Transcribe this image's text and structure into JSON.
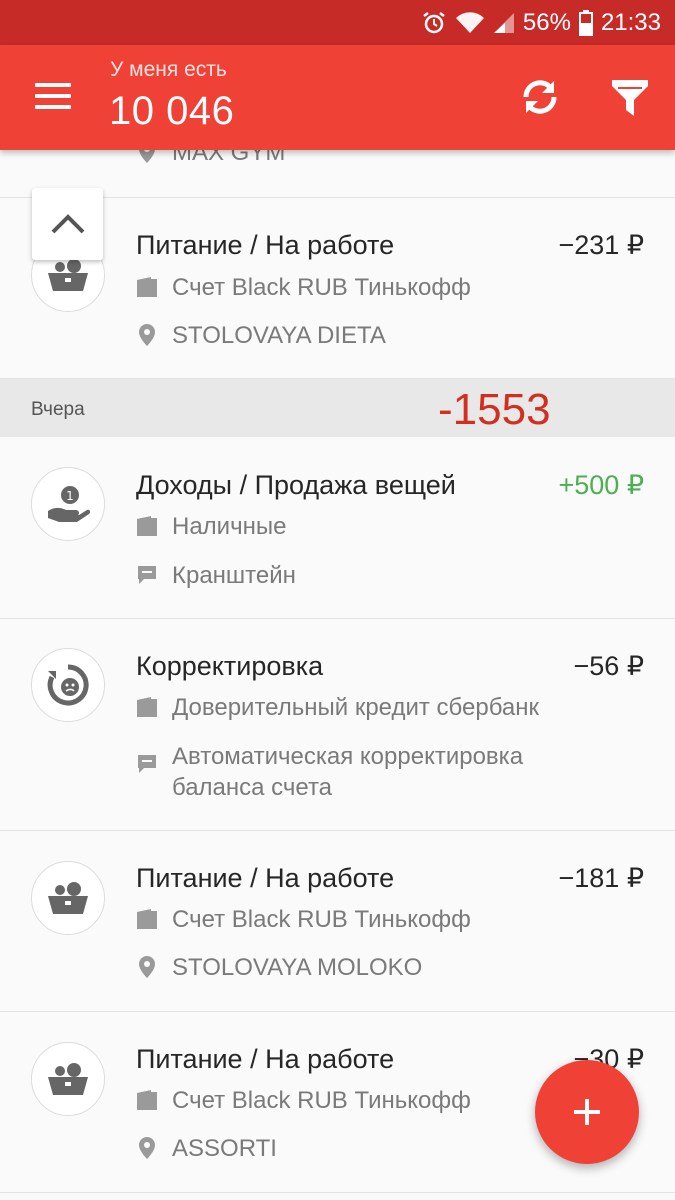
{
  "status_bar": {
    "battery": "56%",
    "time": "21:33"
  },
  "header": {
    "balance_caption": "У меня есть",
    "balance": "10 046",
    "menu_icon": "hamburger-menu-icon",
    "sync_icon": "sync-icon",
    "filter_icon": "filter-icon"
  },
  "partial_item": {
    "place": "MAX GYM"
  },
  "transactions_today": [
    {
      "category": "Питание  / На работе",
      "amount": "−231 ₽",
      "account": "Счет Black RUB Тинькофф",
      "place": "STOLOVAYA DIETA",
      "icon": "basket-icon"
    }
  ],
  "day_group": {
    "label": "Вчера",
    "total": "-1553"
  },
  "transactions_yesterday": [
    {
      "category": "Доходы / Продажа вещей",
      "amount": "+500 ₽",
      "account": "Наличные",
      "note": "Кранштейн",
      "icon": "hand-coin-icon"
    },
    {
      "category": "Корректировка",
      "amount": "−56 ₽",
      "account": "Доверительный кредит сбербанк",
      "note": "Автоматическая корректировка баланса счета",
      "icon": "adjustment-icon"
    },
    {
      "category": "Питание  / На работе",
      "amount": "−181 ₽",
      "account": "Счет Black RUB Тинькофф",
      "place": "STOLOVAYA MOLOKO",
      "icon": "basket-icon"
    },
    {
      "category": "Питание  / На работе",
      "amount": "−30 ₽",
      "account": "Счет Black RUB Тинькофф",
      "place": "ASSORTI",
      "icon": "basket-icon"
    }
  ],
  "colors": {
    "primary": "#ef4136",
    "status_bar": "#c62b28",
    "income": "#4caf50",
    "day_total": "#d32f1e"
  }
}
